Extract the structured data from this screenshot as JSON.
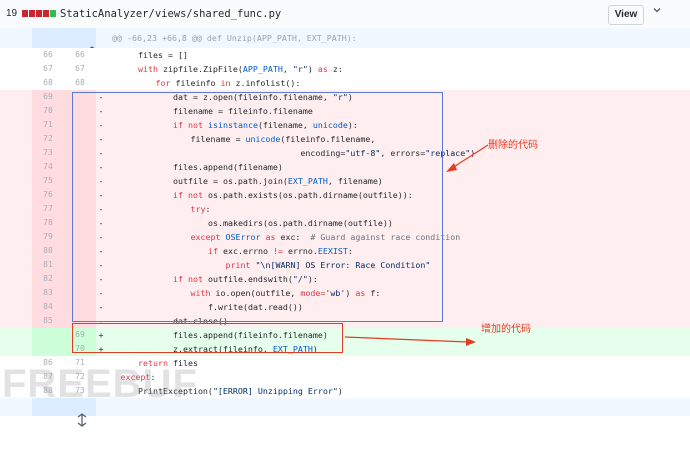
{
  "file_header": {
    "diffstat_count": "19",
    "diffstat_bars": [
      "del",
      "del",
      "del",
      "del",
      "add"
    ],
    "path": "StaticAnalyzer/views/shared_func.py",
    "view_button": "View",
    "menu_icon": "chevron-down-icon"
  },
  "hunk": {
    "header": "@@ -66,23 +66,8 @@ def Unzip(APP_PATH, EXT_PATH):"
  },
  "lines": [
    {
      "type": "ctx",
      "old": "66",
      "new": "66",
      "sign": "",
      "indent": 0,
      "tokens": [
        {
          "t": "files = []",
          "c": ""
        }
      ]
    },
    {
      "type": "ctx",
      "old": "67",
      "new": "67",
      "sign": "",
      "indent": 0,
      "tokens": [
        {
          "t": "with",
          "c": "kw"
        },
        {
          "t": " zipfile.ZipFile(",
          "c": ""
        },
        {
          "t": "APP_PATH",
          "c": "bi"
        },
        {
          "t": ", ",
          "c": ""
        },
        {
          "t": "\"r\"",
          "c": "st"
        },
        {
          "t": ") ",
          "c": ""
        },
        {
          "t": "as",
          "c": "kw"
        },
        {
          "t": " z:",
          "c": ""
        }
      ]
    },
    {
      "type": "ctx",
      "old": "68",
      "new": "68",
      "sign": "",
      "indent": 1,
      "tokens": [
        {
          "t": "for",
          "c": "kw"
        },
        {
          "t": " fileinfo ",
          "c": ""
        },
        {
          "t": "in",
          "c": "kw"
        },
        {
          "t": " z.infolist():",
          "c": ""
        }
      ]
    },
    {
      "type": "del",
      "old": "69",
      "new": "",
      "sign": "-",
      "indent": 2,
      "tokens": [
        {
          "t": "dat = z.open(fileinfo.filename, ",
          "c": ""
        },
        {
          "t": "\"r\"",
          "c": "st"
        },
        {
          "t": ")",
          "c": ""
        }
      ]
    },
    {
      "type": "del",
      "old": "70",
      "new": "",
      "sign": "-",
      "indent": 2,
      "tokens": [
        {
          "t": "filename = fileinfo.filename",
          "c": ""
        }
      ]
    },
    {
      "type": "del",
      "old": "71",
      "new": "",
      "sign": "-",
      "indent": 2,
      "tokens": [
        {
          "t": "if not",
          "c": "kw"
        },
        {
          "t": " ",
          "c": ""
        },
        {
          "t": "isinstance",
          "c": "bi"
        },
        {
          "t": "(filename, ",
          "c": ""
        },
        {
          "t": "unicode",
          "c": "bi"
        },
        {
          "t": "):",
          "c": ""
        }
      ]
    },
    {
      "type": "del",
      "old": "72",
      "new": "",
      "sign": "-",
      "indent": 3,
      "tokens": [
        {
          "t": "filename = ",
          "c": ""
        },
        {
          "t": "unicode",
          "c": "bi"
        },
        {
          "t": "(fileinfo.filename,",
          "c": ""
        }
      ]
    },
    {
      "type": "del",
      "old": "73",
      "new": "",
      "sign": "-",
      "indent": 3,
      "tokens": [
        {
          "t": "                      encoding=",
          "c": ""
        },
        {
          "t": "\"utf-8\"",
          "c": "st"
        },
        {
          "t": ", errors=",
          "c": ""
        },
        {
          "t": "\"replace\"",
          "c": "st"
        },
        {
          "t": ")",
          "c": ""
        }
      ]
    },
    {
      "type": "del",
      "old": "74",
      "new": "",
      "sign": "-",
      "indent": 2,
      "tokens": [
        {
          "t": "files.append(filename)",
          "c": ""
        }
      ]
    },
    {
      "type": "del",
      "old": "75",
      "new": "",
      "sign": "-",
      "indent": 2,
      "tokens": [
        {
          "t": "outfile = os.path.join(",
          "c": ""
        },
        {
          "t": "EXT_PATH",
          "c": "bi"
        },
        {
          "t": ", filename)",
          "c": ""
        }
      ]
    },
    {
      "type": "del",
      "old": "76",
      "new": "",
      "sign": "-",
      "indent": 2,
      "tokens": [
        {
          "t": "if not",
          "c": "kw"
        },
        {
          "t": " os.path.exists(os.path.dirname(outfile)):",
          "c": ""
        }
      ]
    },
    {
      "type": "del",
      "old": "77",
      "new": "",
      "sign": "-",
      "indent": 3,
      "tokens": [
        {
          "t": "try",
          "c": "kw"
        },
        {
          "t": ":",
          "c": ""
        }
      ]
    },
    {
      "type": "del",
      "old": "78",
      "new": "",
      "sign": "-",
      "indent": 4,
      "tokens": [
        {
          "t": "os.makedirs(os.path.dirname(outfile))",
          "c": ""
        }
      ]
    },
    {
      "type": "del",
      "old": "79",
      "new": "",
      "sign": "-",
      "indent": 3,
      "tokens": [
        {
          "t": "except",
          "c": "kw"
        },
        {
          "t": " ",
          "c": ""
        },
        {
          "t": "OSError",
          "c": "bi"
        },
        {
          "t": " ",
          "c": ""
        },
        {
          "t": "as",
          "c": "kw"
        },
        {
          "t": " exc:  ",
          "c": ""
        },
        {
          "t": "# Guard against race condition",
          "c": "cm"
        }
      ]
    },
    {
      "type": "del",
      "old": "80",
      "new": "",
      "sign": "-",
      "indent": 4,
      "tokens": [
        {
          "t": "if",
          "c": "kw"
        },
        {
          "t": " exc.errno ",
          "c": ""
        },
        {
          "t": "!=",
          "c": "kw"
        },
        {
          "t": " errno.",
          "c": ""
        },
        {
          "t": "EEXIST",
          "c": "bi"
        },
        {
          "t": ":",
          "c": ""
        }
      ]
    },
    {
      "type": "del",
      "old": "81",
      "new": "",
      "sign": "-",
      "indent": 5,
      "tokens": [
        {
          "t": "print",
          "c": "kw"
        },
        {
          "t": " ",
          "c": ""
        },
        {
          "t": "\"\\n[WARN] OS Error: Race Condition\"",
          "c": "st"
        }
      ]
    },
    {
      "type": "del",
      "old": "82",
      "new": "",
      "sign": "-",
      "indent": 2,
      "tokens": [
        {
          "t": "if not",
          "c": "kw"
        },
        {
          "t": " outfile.endswith(",
          "c": ""
        },
        {
          "t": "\"/\"",
          "c": "st"
        },
        {
          "t": "):",
          "c": ""
        }
      ]
    },
    {
      "type": "del",
      "old": "83",
      "new": "",
      "sign": "-",
      "indent": 3,
      "tokens": [
        {
          "t": "with",
          "c": "kw"
        },
        {
          "t": " io.open(outfile, ",
          "c": ""
        },
        {
          "t": "mode",
          "c": "kw"
        },
        {
          "t": "=",
          "c": "kw"
        },
        {
          "t": "'wb'",
          "c": "st"
        },
        {
          "t": ") ",
          "c": ""
        },
        {
          "t": "as",
          "c": "kw"
        },
        {
          "t": " f:",
          "c": ""
        }
      ]
    },
    {
      "type": "del",
      "old": "84",
      "new": "",
      "sign": "-",
      "indent": 4,
      "tokens": [
        {
          "t": "f.write(dat.read())",
          "c": ""
        }
      ]
    },
    {
      "type": "del",
      "old": "85",
      "new": "",
      "sign": "-",
      "indent": 2,
      "tokens": [
        {
          "t": "dat.close()",
          "c": ""
        }
      ]
    },
    {
      "type": "add",
      "old": "",
      "new": "69",
      "sign": "+",
      "indent": 2,
      "tokens": [
        {
          "t": "files.append(fileinfo.filename)",
          "c": ""
        }
      ]
    },
    {
      "type": "add",
      "old": "",
      "new": "70",
      "sign": "+",
      "indent": 2,
      "tokens": [
        {
          "t": "z.extract(fileinfo, ",
          "c": ""
        },
        {
          "t": "EXT_PATH",
          "c": "bi"
        },
        {
          "t": ")",
          "c": ""
        }
      ]
    },
    {
      "type": "ctx",
      "old": "86",
      "new": "71",
      "sign": "",
      "indent": 0,
      "tokens": [
        {
          "t": "return",
          "c": "kw"
        },
        {
          "t": " files",
          "c": ""
        }
      ]
    },
    {
      "type": "ctx",
      "old": "87",
      "new": "72",
      "sign": "",
      "indent": -1,
      "tokens": [
        {
          "t": "except",
          "c": "kw"
        },
        {
          "t": ":",
          "c": ""
        }
      ]
    },
    {
      "type": "ctx",
      "old": "88",
      "new": "73",
      "sign": "",
      "indent": 0,
      "tokens": [
        {
          "t": "PrintException(",
          "c": ""
        },
        {
          "t": "\"[ERROR] Unzipping Error\"",
          "c": "st"
        },
        {
          "t": ")",
          "c": ""
        }
      ]
    }
  ],
  "annotations": {
    "deleted_label": "删除的代码",
    "added_label": "增加的代码",
    "color": "#e33b25",
    "deleted_box_color": "#5b7ad6"
  },
  "watermark": "FREEBUF",
  "colors": {
    "deletion_bg": "#ffeef0",
    "addition_bg": "#e6ffed",
    "hunk_bg": "#f1f8ff"
  }
}
